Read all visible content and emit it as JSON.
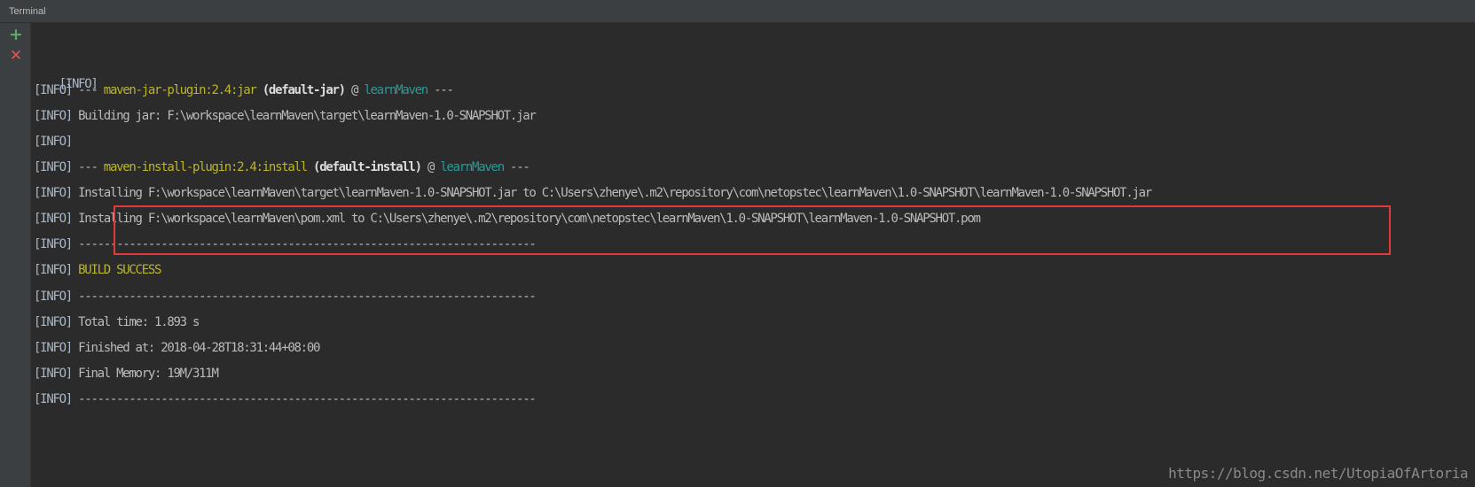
{
  "window": {
    "title": "Terminal"
  },
  "toolbar": {
    "add_icon": "+",
    "close_icon": "✕"
  },
  "terminal": {
    "tag": "[INFO]",
    "lines": [
      {
        "text": ""
      },
      {
        "dashes": "---",
        "plugin": "maven-jar-plugin:2.4:jar",
        "goal": "(default-jar)",
        "at": "@",
        "project": "learnMaven",
        "dashes_end": "---"
      },
      {
        "text": "Building jar: F:\\workspace\\learnMaven\\target\\learnMaven-1.0-SNAPSHOT.jar"
      },
      {
        "text": ""
      },
      {
        "dashes": "---",
        "plugin": "maven-install-plugin:2.4:install",
        "goal": "(default-install)",
        "at": "@",
        "project": "learnMaven",
        "dashes_end": "---"
      },
      {
        "text": "Installing F:\\workspace\\learnMaven\\target\\learnMaven-1.0-SNAPSHOT.jar to C:\\Users\\zhenye\\.m2\\repository\\com\\netopstec\\learnMaven\\1.0-SNAPSHOT\\learnMaven-1.0-SNAPSHOT.jar"
      },
      {
        "text": "Installing F:\\workspace\\learnMaven\\pom.xml to C:\\Users\\zhenye\\.m2\\repository\\com\\netopstec\\learnMaven\\1.0-SNAPSHOT\\learnMaven-1.0-SNAPSHOT.pom"
      },
      {
        "text": "------------------------------------------------------------------------"
      },
      {
        "text": "BUILD SUCCESS"
      },
      {
        "text": "------------------------------------------------------------------------"
      },
      {
        "text": "Total time: 1.893 s"
      },
      {
        "text": "Finished at: 2018-04-28T18:31:44+08:00"
      },
      {
        "text": "Final Memory: 19M/311M"
      },
      {
        "text": "------------------------------------------------------------------------"
      }
    ]
  },
  "watermark": "https://blog.csdn.net/UtopiaOfArtoria",
  "colors": {
    "background": "#2b2b2b",
    "text": "#bbbbbb",
    "plugin": "#bbb529",
    "project": "#299999",
    "success": "#bbb529",
    "highlight_border": "#e03c3c",
    "add_icon": "#59a869",
    "close_icon": "#e05555"
  }
}
